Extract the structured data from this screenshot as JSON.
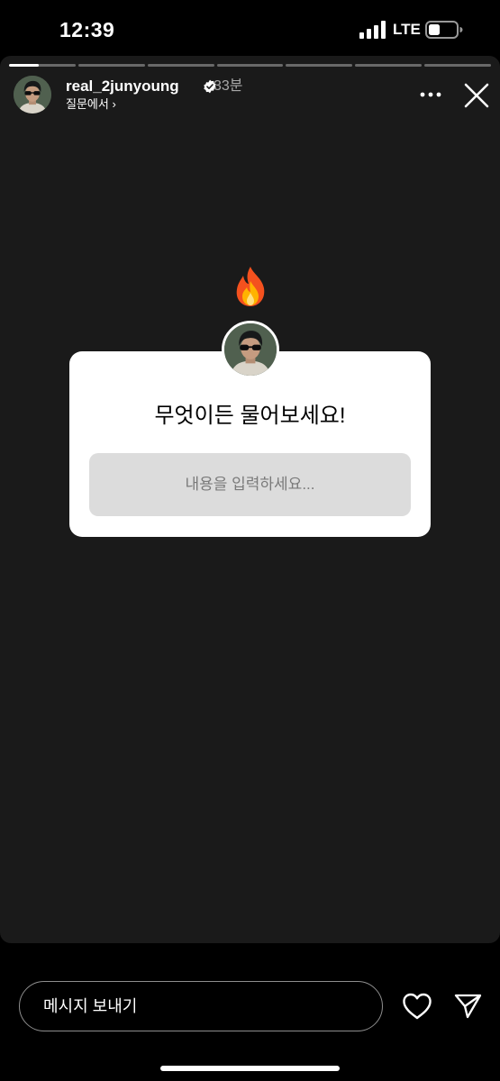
{
  "status_bar": {
    "time": "12:39",
    "network": "LTE",
    "icons": [
      "signal-bars-icon",
      "battery-icon"
    ]
  },
  "story": {
    "progress": {
      "segment_count": 7,
      "current_index": 0,
      "current_fraction": 0.45
    },
    "header": {
      "username": "real_2junyoung",
      "verified": true,
      "time_ago": "33분",
      "source_label": "질문에서 ›",
      "icons": [
        "avatar",
        "verified-badge-icon",
        "more-options-icon",
        "close-icon"
      ]
    },
    "sticker_icon": "fire-emoji-icon",
    "question_box": {
      "prompt": "무엇이든 물어보세요!",
      "placeholder": "내용을 입력하세요..."
    }
  },
  "reply_bar": {
    "placeholder": "메시지 보내기",
    "icons": [
      "heart-icon",
      "send-icon"
    ]
  },
  "colors": {
    "background": "#000000",
    "story_background": "#1a1a1a",
    "card_background": "#ffffff",
    "input_fill": "#dcdcdc",
    "secondary_text": "#a8a8a8"
  }
}
